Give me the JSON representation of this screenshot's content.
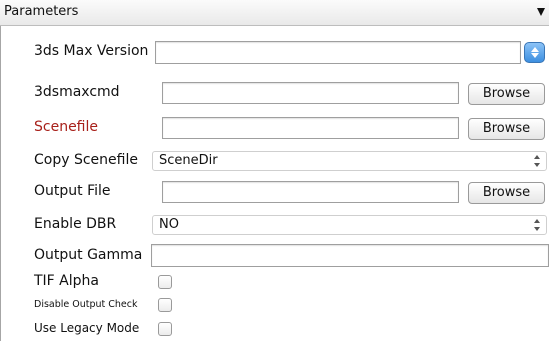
{
  "header": {
    "title": "Parameters"
  },
  "rows": {
    "max_version": {
      "label": "3ds Max Version",
      "value": ""
    },
    "maxcmd": {
      "label": "3dsmaxcmd",
      "value": "",
      "button": "Browse"
    },
    "scenefile": {
      "label": "Scenefile",
      "value": "",
      "button": "Browse",
      "label_color": "#a8201a"
    },
    "copy_scenefile": {
      "label": "Copy Scenefile",
      "selected": "SceneDir"
    },
    "output_file": {
      "label": "Output File",
      "value": "",
      "button": "Browse"
    },
    "enable_dbr": {
      "label": "Enable DBR",
      "selected": "NO"
    },
    "output_gamma": {
      "label": "Output Gamma",
      "value": ""
    },
    "tif_alpha": {
      "label": "TIF Alpha",
      "checked": false
    },
    "disable_output_check": {
      "label": "Disable Output Check",
      "checked": false
    },
    "legacy_mode": {
      "label": "Use Legacy Mode",
      "checked": false
    }
  },
  "icons": {
    "header": "dropdown-arrow-icon",
    "stepper": "stepper-icon",
    "select": "up-down-arrows-icon"
  },
  "colors": {
    "accent": "#3d8fe0",
    "required_label": "#a8201a"
  }
}
